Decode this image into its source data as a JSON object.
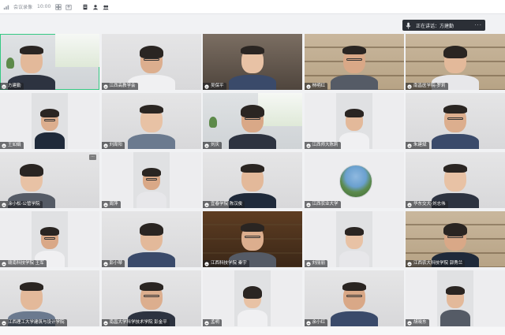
{
  "topbar": {
    "app_label": "会议录像",
    "time": "10:00",
    "icons": [
      "signal-icon",
      "grid-icon",
      "share-icon",
      "doc-icon",
      "user-icon",
      "group-icon"
    ]
  },
  "speaker": {
    "label": "正在讲话：",
    "name": "方建勤"
  },
  "participants": [
    {
      "name": "方建勤",
      "scene": "room",
      "active": true
    },
    {
      "name": "江西高教学会",
      "scene": "wall"
    },
    {
      "name": "吴保平",
      "scene": "dark"
    },
    {
      "name": "林明红",
      "scene": "shelf"
    },
    {
      "name": "南昌医学院-罗莉",
      "scene": "shelf"
    },
    {
      "name": "王如娟",
      "scene": "blank"
    },
    {
      "name": "刘周阳",
      "scene": "wall"
    },
    {
      "name": "刘庆",
      "scene": "room"
    },
    {
      "name": "江西师大陈莉",
      "scene": "blank"
    },
    {
      "name": "朱建斌",
      "scene": "wall"
    },
    {
      "name": "涂小松-公管学院",
      "scene": "wall"
    },
    {
      "name": "周萍",
      "scene": "blank"
    },
    {
      "name": "宜春学院 陈汉俊",
      "scene": "wall"
    },
    {
      "name": "江西农业大学",
      "scene": "avatar"
    },
    {
      "name": "华东交大-刘志伟",
      "scene": "wall"
    },
    {
      "name": "赣南科技学院 王军",
      "scene": "blank"
    },
    {
      "name": "彭小琴",
      "scene": "wall"
    },
    {
      "name": "江西科技学院 秦宇",
      "scene": "wood"
    },
    {
      "name": "刘丽丽",
      "scene": "blank"
    },
    {
      "name": "江西农大科技学院 郭秀兰",
      "scene": "shelf"
    },
    {
      "name": "江西理工大学建筑与设计学院",
      "scene": "wall"
    },
    {
      "name": "南昌大学科学技术学院 彭金平",
      "scene": "wall"
    },
    {
      "name": "孟明",
      "scene": "blank"
    },
    {
      "name": "余小红",
      "scene": "wall"
    },
    {
      "name": "胡晓东",
      "scene": "blank"
    }
  ],
  "colors": {
    "active_border": "#35c983",
    "topbar_bg": "#ffffff",
    "pill_bg": "#2b2f36"
  }
}
